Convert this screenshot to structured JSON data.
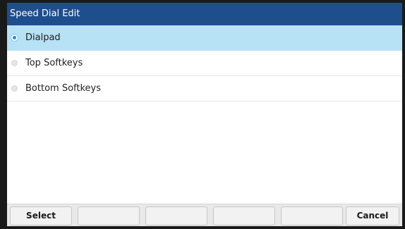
{
  "title": "Speed Dial Edit",
  "options": [
    {
      "label": "Dialpad",
      "selected": true
    },
    {
      "label": "Top Softkeys",
      "selected": false
    },
    {
      "label": "Bottom Softkeys",
      "selected": false
    }
  ],
  "softkeys": [
    "Select",
    "",
    "",
    "",
    "",
    "Cancel"
  ],
  "colors": {
    "title_bar": "#1f4e8c",
    "selected_row": "#b7e1f4",
    "radio_on": "#2a8bd6"
  }
}
